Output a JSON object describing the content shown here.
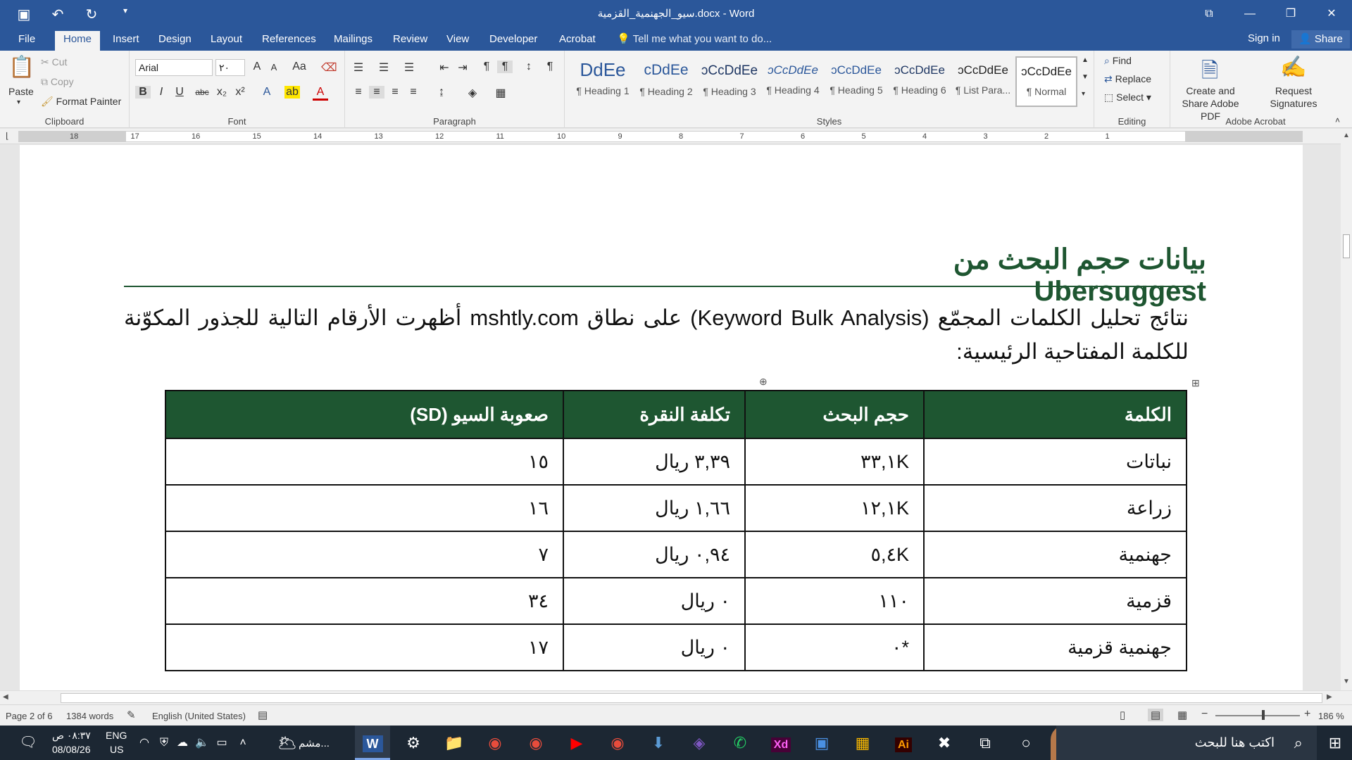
{
  "titlebar": {
    "doc_title": "سيو_الجهنمية_القزمية.docx - Word",
    "save_icon": "save-icon",
    "undo_icon": "undo-icon",
    "redo_icon": "redo-icon"
  },
  "tabs": [
    "File",
    "Home",
    "Insert",
    "Design",
    "Layout",
    "References",
    "Mailings",
    "Review",
    "View",
    "Developer",
    "Acrobat"
  ],
  "tell_me": "Tell me what you want to do...",
  "sign_in": "Sign in",
  "share": "Share",
  "clipboard": {
    "paste": "Paste",
    "cut": "Cut",
    "copy": "Copy",
    "format_painter": "Format Painter",
    "label": "Clipboard"
  },
  "font": {
    "name": "Arial",
    "size": "٢٠",
    "label": "Font"
  },
  "paragraph": {
    "label": "Paragraph"
  },
  "styles": {
    "label": "Styles",
    "items": [
      {
        "sample": "DdEe",
        "name": "¶ Heading 1"
      },
      {
        "sample": "cDdEe",
        "name": "¶ Heading 2"
      },
      {
        "sample": "ɔCcDdEe",
        "name": "¶ Heading 3"
      },
      {
        "sample": "ɔCcDdEe",
        "name": "¶ Heading 4"
      },
      {
        "sample": "ɔCcDdEe",
        "name": "¶ Heading 5"
      },
      {
        "sample": "ɔCcDdEe",
        "name": "¶ Heading 6"
      },
      {
        "sample": "ɔCcDdEe",
        "name": "¶ List Para..."
      },
      {
        "sample": "ɔCcDdEe",
        "name": "¶ Normal"
      }
    ]
  },
  "editing": {
    "find": "Find",
    "replace": "Replace",
    "select": "Select",
    "label": "Editing"
  },
  "acrobat": {
    "create_share": "Create and Share Adobe PDF",
    "request_sig": "Request Signatures",
    "label": "Adobe Acrobat"
  },
  "ruler_numbers": [
    "18",
    "17",
    "16",
    "15",
    "14",
    "13",
    "12",
    "11",
    "10",
    "9",
    "8",
    "7",
    "6",
    "5",
    "4",
    "3",
    "2",
    "1"
  ],
  "document": {
    "heading": "بيانات حجم البحث من Ubersuggest",
    "paragraph": "نتائج تحليل الكلمات المجمّع (Keyword Bulk Analysis) على نطاق mshtly.com أظهرت الأرقام التالية للجذور المكوّنة للكلمة المفتاحية الرئيسية:",
    "table": {
      "headers": [
        "الكلمة",
        "حجم البحث",
        "تكلفة النقرة",
        "صعوبة السيو (SD)"
      ],
      "rows": [
        [
          "نباتات",
          "٣٣,١K",
          "٣,٣٩ ريال",
          "١٥"
        ],
        [
          "زراعة",
          "١٢,١K",
          "١,٦٦ ريال",
          "١٦"
        ],
        [
          "جهنمية",
          "٥,٤K",
          "٠,٩٤ ريال",
          "٧"
        ],
        [
          "قزمية",
          "١١٠",
          "٠ ريال",
          "٣٤"
        ],
        [
          "جهنمية قزمية",
          "*٠",
          "٠ ريال",
          "١٧"
        ]
      ]
    }
  },
  "status": {
    "page": "Page 2 of 6",
    "words": "1384 words",
    "language": "English (United States)",
    "zoom": "186 %"
  },
  "taskbar": {
    "search_placeholder": "اكتب هنا للبحث",
    "time": "٠٨:٣٧ ص",
    "date": "08/08/26",
    "lang": "ENG",
    "region": "US",
    "weather_label": "مشم..."
  }
}
